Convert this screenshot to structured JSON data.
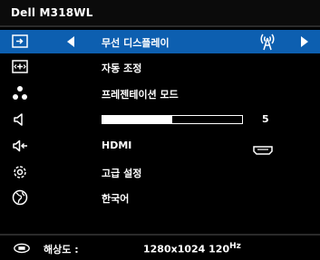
{
  "osd": {
    "title": "Dell M318WL",
    "menu": [
      {
        "label": "무선 디스플레이",
        "icon": "input-source-icon",
        "selected": true
      },
      {
        "label": "자동 조정",
        "icon": "auto-adjust-icon"
      },
      {
        "label": "프레젠테이션 모드",
        "icon": "presentation-mode-icon"
      },
      {
        "label": "",
        "icon": "volume-icon",
        "slider_value": "5",
        "slider_fraction": 0.5
      },
      {
        "label": "HDMI",
        "icon": "audio-input-icon"
      },
      {
        "label": "고급 설정",
        "icon": "advanced-settings-icon"
      },
      {
        "label": "한국어",
        "icon": "language-globe-icon"
      }
    ],
    "status": {
      "label": "해상도 :",
      "value": "1280x1024 120",
      "unit": "Hz"
    },
    "colors": {
      "selected_row": "#0d5fb0",
      "background": "#000000",
      "text": "#ffffff"
    }
  }
}
